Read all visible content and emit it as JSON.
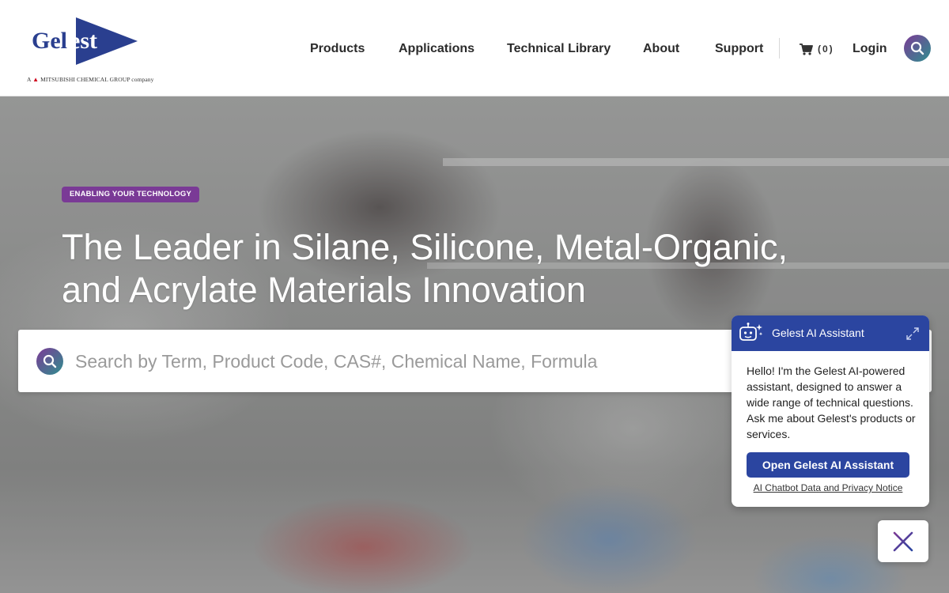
{
  "brand": {
    "logo_text": "Gelest",
    "tagline_prefix": "A",
    "tagline": "MITSUBISHI CHEMICAL GROUP company",
    "colors": {
      "logo_blue": "#2a3f8f",
      "purple": "#7a3a96",
      "teal": "#2f8f8f",
      "chat_blue": "#2b45a0"
    }
  },
  "nav": {
    "items": [
      {
        "label": "Products"
      },
      {
        "label": "Applications"
      },
      {
        "label": "Technical Library"
      },
      {
        "label": "About"
      },
      {
        "label": "Support"
      }
    ],
    "cart_count": "(0)",
    "login_label": "Login",
    "icons": {
      "cart": "cart-icon",
      "search": "search-icon"
    }
  },
  "hero": {
    "eyebrow": "ENABLING YOUR TECHNOLOGY",
    "headline_line1": "The Leader in Silane, Silicone, Metal-Organic,",
    "headline_line2": "and Acrylate Materials Innovation",
    "search_placeholder": "Search by Term, Product Code, CAS#, Chemical Name, Formula"
  },
  "chat": {
    "title": "Gelest AI Assistant",
    "message": "Hello! I'm the Gelest AI-powered assistant, designed to answer a wide range of technical questions. Ask me about Gelest's products or services.",
    "button_label": "Open Gelest AI Assistant",
    "privacy_link": "AI Chatbot Data and Privacy Notice",
    "icons": {
      "bot": "chatbot-icon",
      "expand": "expand-icon",
      "close": "close-icon"
    }
  }
}
